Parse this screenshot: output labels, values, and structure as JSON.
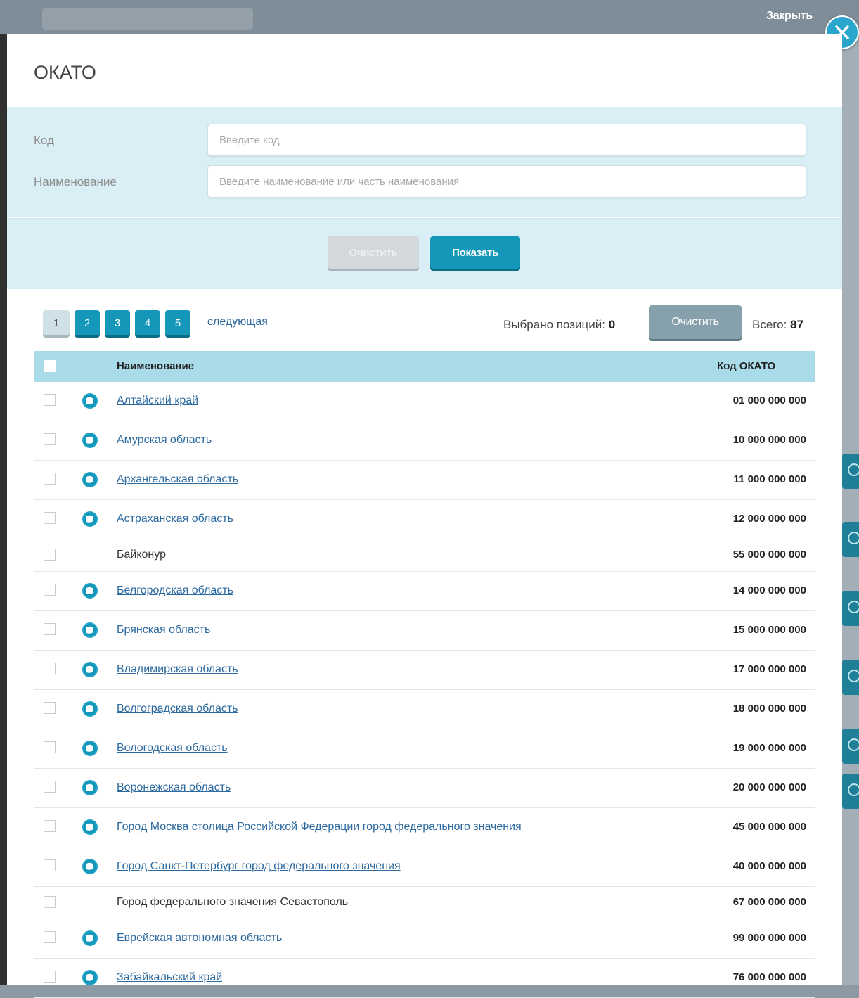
{
  "dialog": {
    "close_label": "Закрыть",
    "title": "ОКАТО"
  },
  "filter": {
    "code_label": "Код",
    "code_placeholder": "Введите код",
    "name_label": "Наименование",
    "name_placeholder": "Введите наименование или часть наименования",
    "clear_button": "Очистить",
    "show_button": "Показать"
  },
  "pagination": {
    "pages": [
      "1",
      "2",
      "3",
      "4",
      "5"
    ],
    "current_page": "1",
    "next_label": "следующая"
  },
  "selection": {
    "selected_label": "Выбрано позиций:",
    "selected_count": "0",
    "clear_button": "Очистить",
    "total_label": "Всего:",
    "total_count": "87"
  },
  "table": {
    "columns": {
      "name": "Наименование",
      "code": "Код ОКАТО"
    },
    "rows": [
      {
        "name": "Алтайский край",
        "code": "01 000 000 000",
        "expandable": true
      },
      {
        "name": "Амурская область",
        "code": "10 000 000 000",
        "expandable": true
      },
      {
        "name": "Архангельская область",
        "code": "11 000 000 000",
        "expandable": true
      },
      {
        "name": "Астраханская область",
        "code": "12 000 000 000",
        "expandable": true
      },
      {
        "name": "Байконур",
        "code": "55 000 000 000",
        "expandable": false
      },
      {
        "name": "Белгородская область",
        "code": "14 000 000 000",
        "expandable": true
      },
      {
        "name": "Брянская область",
        "code": "15 000 000 000",
        "expandable": true
      },
      {
        "name": "Владимирская область",
        "code": "17 000 000 000",
        "expandable": true
      },
      {
        "name": "Волгоградская область",
        "code": "18 000 000 000",
        "expandable": true
      },
      {
        "name": "Вологодская область",
        "code": "19 000 000 000",
        "expandable": true
      },
      {
        "name": "Воронежская область",
        "code": "20 000 000 000",
        "expandable": true
      },
      {
        "name": "Город Москва столица Российской Федерации город федерального значения",
        "code": "45 000 000 000",
        "expandable": true
      },
      {
        "name": "Город Санкт-Петербург город федерального значения",
        "code": "40 000 000 000",
        "expandable": true
      },
      {
        "name": "Город федерального значения Севастополь",
        "code": "67 000 000 000",
        "expandable": false
      },
      {
        "name": "Еврейская автономная область",
        "code": "99 000 000 000",
        "expandable": true
      },
      {
        "name": "Забайкальский край",
        "code": "76 000 000 000",
        "expandable": true
      }
    ]
  },
  "colors": {
    "accent": "#1497b8",
    "header_row": "#a9dbe9",
    "filter_bg": "#daeef5",
    "link": "#2d6aa0"
  },
  "icons": {
    "close": "close-x-icon",
    "expand": "expand-circle-icon"
  }
}
